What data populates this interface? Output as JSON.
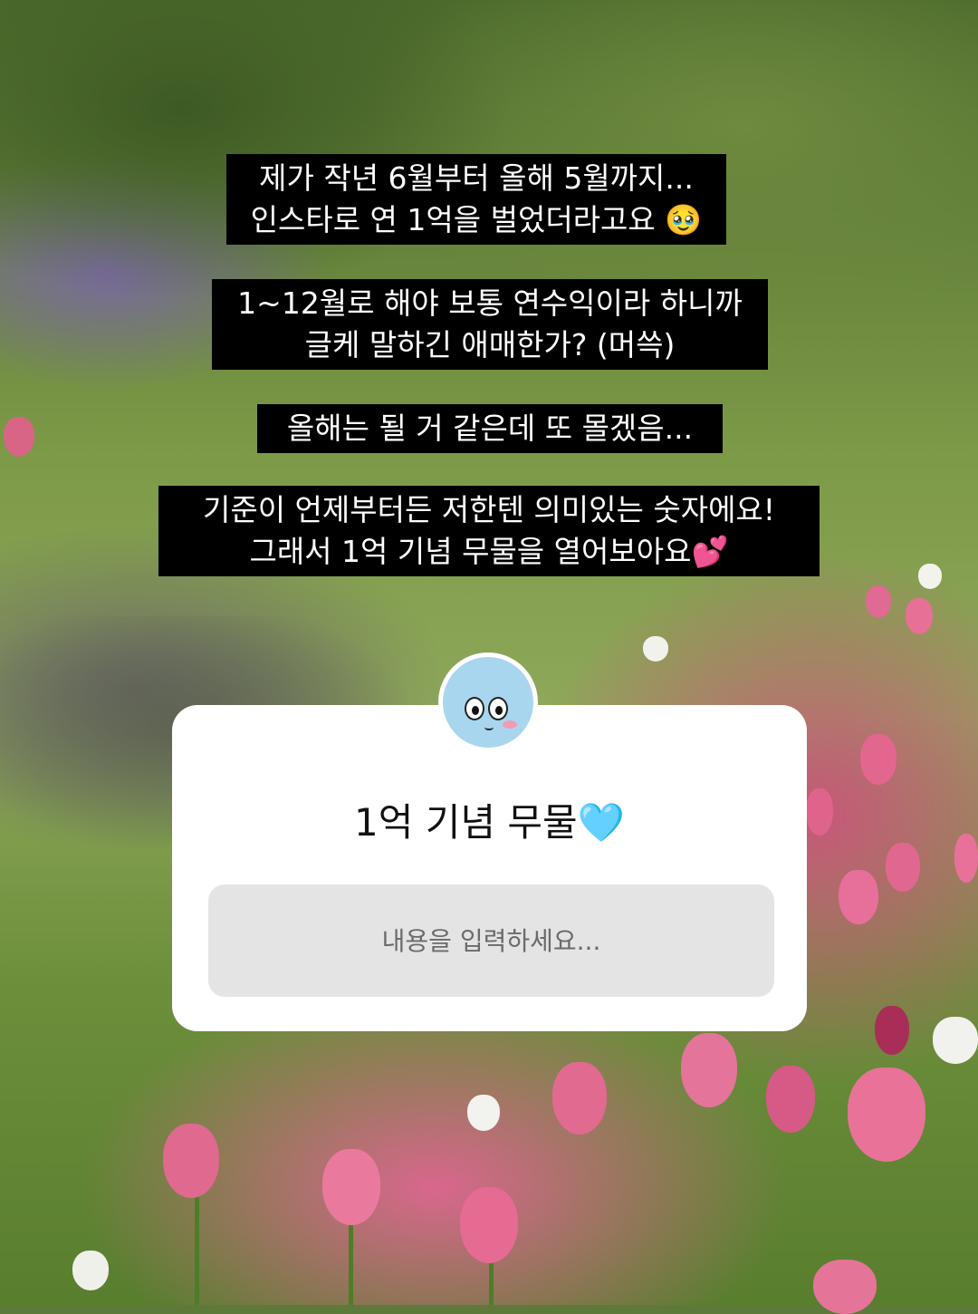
{
  "story": {
    "captions": [
      {
        "lines": [
          "제가 작년 6월부터 올해 5월까지...",
          "인스타로 연 1억을 벌었더라고요 🥹"
        ]
      },
      {
        "lines": [
          "1~12월로 해야 보통 연수익이라 하니까",
          "글케 말하긴 애매한가? (머쓱)"
        ]
      },
      {
        "lines": [
          "올해는 될 거 같은데 또 몰겠음..."
        ]
      },
      {
        "lines": [
          "기준이 언제부터든 저한텐 의미있는 숫자에요!",
          "그래서 1억 기념 무물을 열어보아요💕"
        ]
      }
    ]
  },
  "question_box": {
    "title": "1억 기념 무물🩵",
    "input_placeholder": "내용을 입력하세요...",
    "avatar_color": "#a8d6ee"
  }
}
